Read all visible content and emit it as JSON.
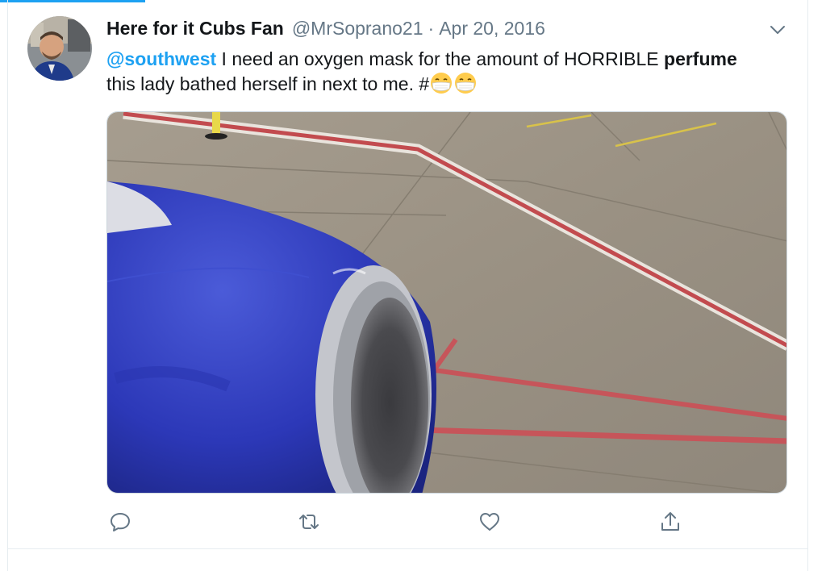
{
  "tweet": {
    "display_name": "Here for it Cubs Fan",
    "handle": "@MrSoprano21",
    "separator": "·",
    "date": "Apr 20, 2016",
    "text": {
      "mention": "@southwest",
      "part1": " I need an oxygen mask for the amount of HORRIBLE ",
      "emphasis": "perfume",
      "part2": " this lady bathed herself in next to me. #"
    },
    "emoji": [
      "face-with-medical-mask",
      "face-with-medical-mask"
    ],
    "media": {
      "description_icon": "photo"
    }
  },
  "actions": {
    "reply_icon": "speech-bubble-icon",
    "retweet_icon": "retweet-icon",
    "like_icon": "heart-icon",
    "share_icon": "share-icon"
  },
  "colors": {
    "accent": "#1da1f2",
    "secondary_text": "#657786",
    "primary_text": "#14171a",
    "border": "#e6ecf0"
  }
}
